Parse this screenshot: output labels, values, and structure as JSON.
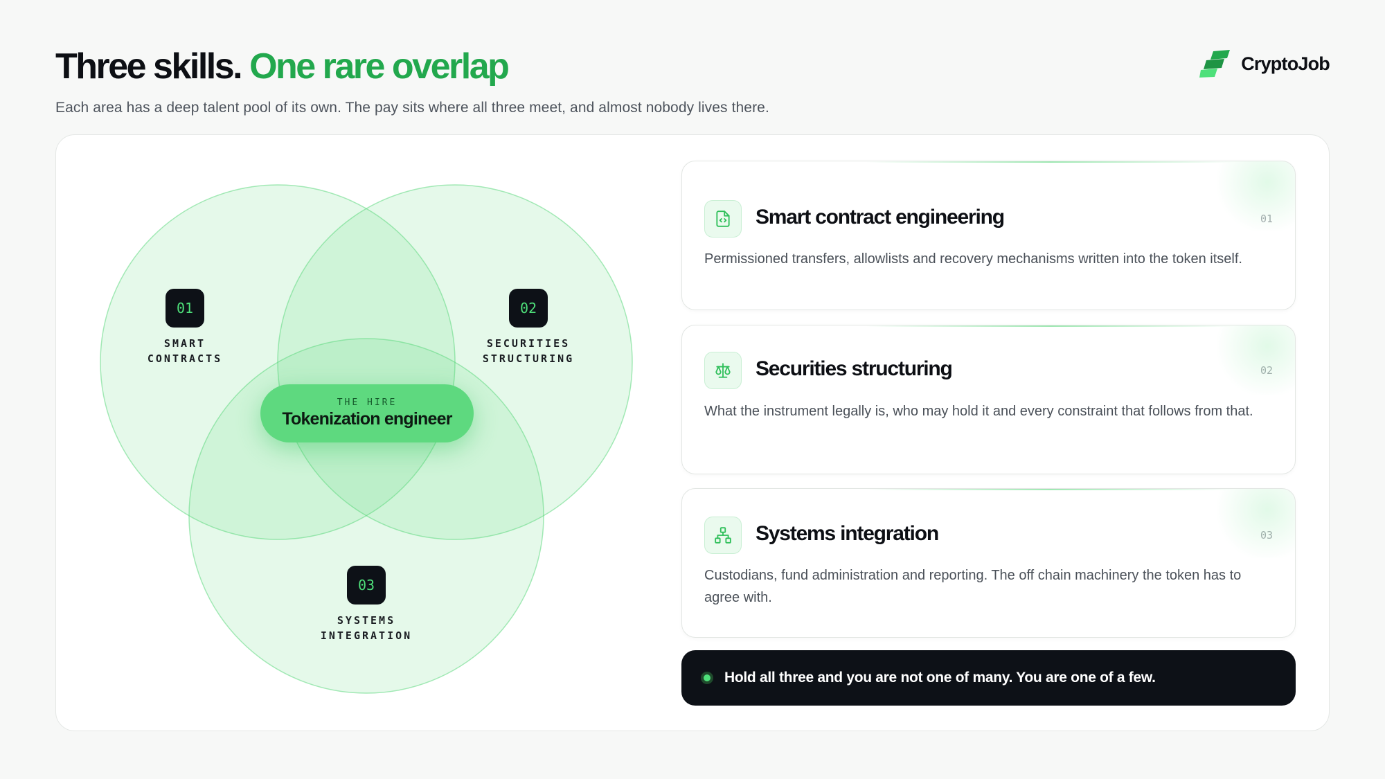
{
  "header": {
    "title_main": "Three skills.",
    "title_accent": "One rare overlap",
    "subtitle": "Each area has a deep talent pool of its own. The pay sits where all three meet, and almost nobody lives there."
  },
  "brand": {
    "name": "CryptoJob",
    "accent_color": "#22a84d",
    "logo_icon": "stacked-bars-logo-icon"
  },
  "venn": {
    "circles": [
      {
        "number": "01",
        "label_line1": "SMART",
        "label_line2": "CONTRACTS"
      },
      {
        "number": "02",
        "label_line1": "SECURITIES",
        "label_line2": "STRUCTURING"
      },
      {
        "number": "03",
        "label_line1": "SYSTEMS",
        "label_line2": "INTEGRATION"
      }
    ],
    "center": {
      "eyebrow": "THE HIRE",
      "title": "Tokenization engineer"
    },
    "fill_color": "#5ed97f"
  },
  "cards": [
    {
      "icon": "code-file-icon",
      "title": "Smart contract engineering",
      "number": "01",
      "description": "Permissioned transfers, allowlists and recovery mechanisms written into the token itself."
    },
    {
      "icon": "scales-icon",
      "title": "Securities structuring",
      "number": "02",
      "description": "What the instrument legally is, who may hold it and every constraint that follows from that."
    },
    {
      "icon": "network-icon",
      "title": "Systems integration",
      "number": "03",
      "description": "Custodians, fund administration and reporting. The off chain machinery the token has to agree with."
    }
  ],
  "banner": {
    "text": "Hold all three and you are not one of many. You are one of a few."
  }
}
